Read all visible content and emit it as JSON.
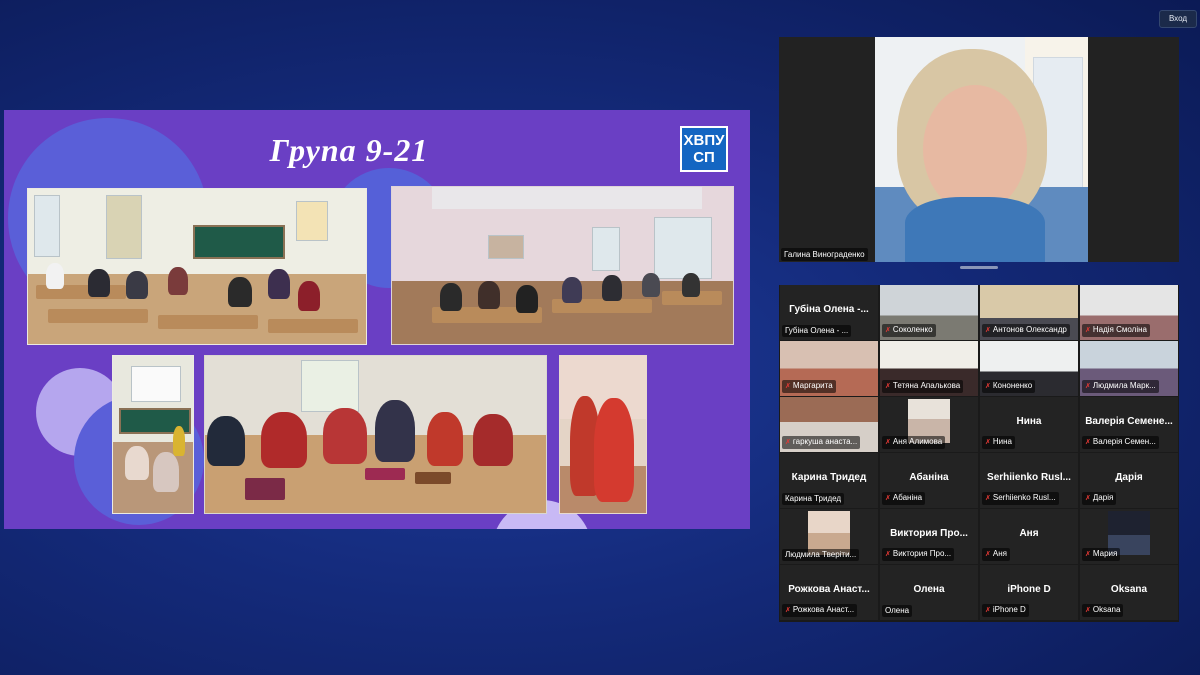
{
  "header": {
    "login_label": "Вход"
  },
  "slide": {
    "title": "Група  9-21",
    "logo_text": "ХВПУ СП",
    "bg_color": "#6a3fc4"
  },
  "speaker": {
    "name": "Галина Винограденко"
  },
  "participants": [
    {
      "title": "Губіна Олена -...",
      "tag": "Губіна Олена - ...",
      "video": false,
      "muted": false
    },
    {
      "title": "",
      "tag": "Соколенко",
      "video": true,
      "muted": true
    },
    {
      "title": "",
      "tag": "Антонов Олександр",
      "video": true,
      "muted": true
    },
    {
      "title": "",
      "tag": "Надія Смоліна",
      "video": true,
      "muted": true
    },
    {
      "title": "",
      "tag": "Маргарита",
      "video": true,
      "muted": true
    },
    {
      "title": "",
      "tag": "Тетяна Апалькова",
      "video": true,
      "muted": true
    },
    {
      "title": "",
      "tag": "Кононенко",
      "video": true,
      "muted": true
    },
    {
      "title": "",
      "tag": "Людмила Марк...",
      "video": true,
      "muted": true
    },
    {
      "title": "",
      "tag": "гаркуша анаста...",
      "video": true,
      "muted": true
    },
    {
      "title": "",
      "tag": "Аня Алимова",
      "video": true,
      "muted": true
    },
    {
      "title": "Нина",
      "tag": "Нина",
      "video": false,
      "muted": true
    },
    {
      "title": "Валерія Семене...",
      "tag": "Валерія Семен...",
      "video": false,
      "muted": true
    },
    {
      "title": "Карина Тридед",
      "tag": "Карина Тридед",
      "video": false,
      "muted": false
    },
    {
      "title": "Абаніна",
      "tag": "Абаніна",
      "video": false,
      "muted": true
    },
    {
      "title": "Serhiienko Rusl...",
      "tag": "Serhiienko Rusl...",
      "video": false,
      "muted": true
    },
    {
      "title": "Дарія",
      "tag": "Дарія",
      "video": false,
      "muted": true
    },
    {
      "title": "",
      "tag": "Людмила Тверіти...",
      "video": true,
      "muted": false
    },
    {
      "title": "Виктория Про...",
      "tag": "Виктория Про...",
      "video": false,
      "muted": true
    },
    {
      "title": "Аня",
      "tag": "Аня",
      "video": false,
      "muted": true
    },
    {
      "title": "",
      "tag": "Мария",
      "video": true,
      "muted": true
    },
    {
      "title": "Рожкова Анаст...",
      "tag": "Рожкова Анаст...",
      "video": false,
      "muted": true
    },
    {
      "title": "Олена",
      "tag": "Олена",
      "video": false,
      "muted": false
    },
    {
      "title": "iPhone D",
      "tag": "iPhone D",
      "video": false,
      "muted": true
    },
    {
      "title": "Oksana",
      "tag": "Oksana",
      "video": false,
      "muted": true
    }
  ]
}
